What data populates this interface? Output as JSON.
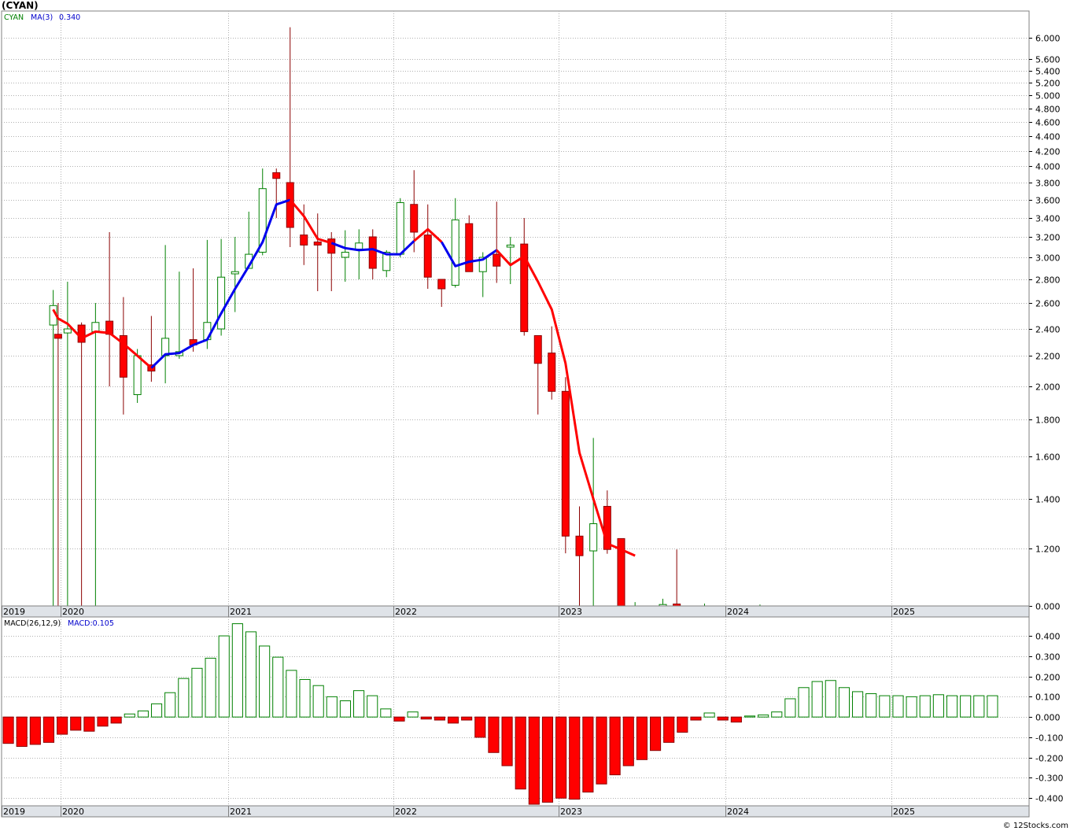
{
  "title": "(CYAN)",
  "watermark": "© 12Stocks.com",
  "legend_price": {
    "ma_label": "MA(3)",
    "ticker": "CYAN",
    "ma_value": "0.340"
  },
  "legend_macd": {
    "name": "MACD(26,12,9)",
    "value": "MACD:0.105"
  },
  "chart_data": [
    {
      "type": "candlestick",
      "panel": "price",
      "yticks": [
        "0.000",
        "1.200",
        "1.400",
        "1.600",
        "1.800",
        "2.000",
        "2.200",
        "2.400",
        "2.600",
        "2.800",
        "3.000",
        "3.200",
        "3.400",
        "3.600",
        "3.800",
        "4.000",
        "4.200",
        "4.400",
        "4.600",
        "4.800",
        "5.000",
        "5.200",
        "5.400",
        "5.600",
        "6.000"
      ],
      "xticks": [
        "2019",
        "2020",
        "2021",
        "2022",
        "2023",
        "2024",
        "2025"
      ],
      "up_color": "#008000",
      "down_color": "#ff0000",
      "ma_up_color": "#0000ee",
      "ma_down_color": "#ff0000",
      "candles": [
        {
          "d": "2019-11",
          "o": 2.43,
          "h": 2.71,
          "l": 0.0,
          "c": 2.58
        },
        {
          "d": "2019-12",
          "o": 2.36,
          "h": 2.6,
          "l": 0.0,
          "c": 2.33
        },
        {
          "d": "2020-01",
          "o": 2.37,
          "h": 2.78,
          "l": 0.0,
          "c": 2.4
        },
        {
          "d": "2020-02",
          "o": 2.43,
          "h": 2.45,
          "l": 0.0,
          "c": 2.3
        },
        {
          "d": "2020-03",
          "o": 2.38,
          "h": 2.6,
          "l": 0.0,
          "c": 2.45
        },
        {
          "d": "2020-04",
          "o": 2.46,
          "h": 3.25,
          "l": 2.0,
          "c": 2.36
        },
        {
          "d": "2020-05",
          "o": 2.35,
          "h": 2.65,
          "l": 1.83,
          "c": 2.06
        },
        {
          "d": "2020-06",
          "o": 1.95,
          "h": 2.25,
          "l": 1.9,
          "c": 2.2
        },
        {
          "d": "2020-07",
          "o": 2.14,
          "h": 2.5,
          "l": 2.03,
          "c": 2.1
        },
        {
          "d": "2020-08",
          "o": 2.2,
          "h": 3.12,
          "l": 2.02,
          "c": 2.33
        },
        {
          "d": "2020-09",
          "o": 2.2,
          "h": 2.87,
          "l": 2.18,
          "c": 2.23
        },
        {
          "d": "2020-10",
          "o": 2.32,
          "h": 2.9,
          "l": 2.23,
          "c": 2.28
        },
        {
          "d": "2020-11",
          "o": 2.32,
          "h": 3.17,
          "l": 2.25,
          "c": 2.45
        },
        {
          "d": "2020-12",
          "o": 2.4,
          "h": 3.18,
          "l": 2.35,
          "c": 2.82
        },
        {
          "d": "2021-01",
          "o": 2.85,
          "h": 3.2,
          "l": 2.53,
          "c": 2.87
        },
        {
          "d": "2021-02",
          "o": 2.9,
          "h": 3.47,
          "l": 2.9,
          "c": 3.03
        },
        {
          "d": "2021-03",
          "o": 3.05,
          "h": 3.97,
          "l": 3.02,
          "c": 3.73
        },
        {
          "d": "2021-04",
          "o": 3.92,
          "h": 3.97,
          "l": 3.4,
          "c": 3.85
        },
        {
          "d": "2021-05",
          "o": 3.8,
          "h": 6.2,
          "l": 3.1,
          "c": 3.3
        },
        {
          "d": "2021-06",
          "o": 3.22,
          "h": 3.55,
          "l": 2.93,
          "c": 3.12
        },
        {
          "d": "2021-07",
          "o": 3.15,
          "h": 3.45,
          "l": 2.7,
          "c": 3.12
        },
        {
          "d": "2021-08",
          "o": 3.18,
          "h": 3.25,
          "l": 2.7,
          "c": 3.04
        },
        {
          "d": "2021-09",
          "o": 3.0,
          "h": 3.27,
          "l": 2.78,
          "c": 3.05
        },
        {
          "d": "2021-10",
          "o": 3.08,
          "h": 3.28,
          "l": 2.8,
          "c": 3.14
        },
        {
          "d": "2021-11",
          "o": 3.2,
          "h": 3.28,
          "l": 2.8,
          "c": 2.9
        },
        {
          "d": "2021-12",
          "o": 2.88,
          "h": 3.07,
          "l": 2.82,
          "c": 3.05
        },
        {
          "d": "2022-01",
          "o": 3.03,
          "h": 3.62,
          "l": 3.0,
          "c": 3.57
        },
        {
          "d": "2022-02",
          "o": 3.55,
          "h": 3.95,
          "l": 3.05,
          "c": 3.25
        },
        {
          "d": "2022-03",
          "o": 3.22,
          "h": 3.55,
          "l": 2.72,
          "c": 2.82
        },
        {
          "d": "2022-04",
          "o": 2.8,
          "h": 2.8,
          "l": 2.57,
          "c": 2.72
        },
        {
          "d": "2022-05",
          "o": 2.75,
          "h": 3.62,
          "l": 2.73,
          "c": 3.38
        },
        {
          "d": "2022-06",
          "o": 3.34,
          "h": 3.43,
          "l": 2.87,
          "c": 2.87
        },
        {
          "d": "2022-07",
          "o": 2.87,
          "h": 3.05,
          "l": 2.65,
          "c": 3.0
        },
        {
          "d": "2022-08",
          "o": 3.03,
          "h": 3.58,
          "l": 2.77,
          "c": 2.92
        },
        {
          "d": "2022-09",
          "o": 3.1,
          "h": 3.2,
          "l": 2.76,
          "c": 3.12
        },
        {
          "d": "2022-10",
          "o": 3.13,
          "h": 3.4,
          "l": 2.35,
          "c": 2.38
        },
        {
          "d": "2022-11",
          "o": 2.35,
          "h": 2.35,
          "l": 1.83,
          "c": 2.15
        },
        {
          "d": "2022-12",
          "o": 2.22,
          "h": 2.42,
          "l": 1.92,
          "c": 1.97
        },
        {
          "d": "2023-01",
          "o": 1.97,
          "h": 2.06,
          "l": 1.1,
          "c": 1.25
        },
        {
          "d": "2023-02",
          "o": 1.25,
          "h": 1.37,
          "l": 0.0,
          "c": 1.05
        },
        {
          "d": "2023-03",
          "o": 1.15,
          "h": 1.7,
          "l": 0.0,
          "c": 1.3
        },
        {
          "d": "2023-04",
          "o": 1.37,
          "h": 1.44,
          "l": 1.09,
          "c": 1.18
        },
        {
          "d": "2023-05",
          "o": 1.24,
          "h": 1.24,
          "l": 0.0,
          "c": 0.0
        },
        {
          "d": "2023-06",
          "o": 0.0,
          "h": 0.08,
          "l": 0.0,
          "c": 0.0
        },
        {
          "d": "2023-07",
          "o": 0.0,
          "h": 0.0,
          "l": 0.0,
          "c": 0.0
        },
        {
          "d": "2023-08",
          "o": 0.0,
          "h": 0.15,
          "l": 0.0,
          "c": 0.03
        },
        {
          "d": "2023-09",
          "o": 0.04,
          "h": 1.18,
          "l": 0.0,
          "c": 0.0
        },
        {
          "d": "2023-10",
          "o": 0.0,
          "h": 0.0,
          "l": 0.0,
          "c": 0.0
        },
        {
          "d": "2023-11",
          "o": 0.0,
          "h": 0.05,
          "l": 0.0,
          "c": 0.0
        },
        {
          "d": "2023-12",
          "o": 0.0,
          "h": 0.0,
          "l": 0.0,
          "c": 0.0
        },
        {
          "d": "2024-01",
          "o": 0.0,
          "h": 0.0,
          "l": 0.0,
          "c": 0.0
        },
        {
          "d": "2024-02",
          "o": 0.0,
          "h": 0.0,
          "l": 0.0,
          "c": 0.0
        },
        {
          "d": "2024-03",
          "o": 0.0,
          "h": 0.03,
          "l": 0.0,
          "c": 0.0
        }
      ],
      "ma3": [
        2.55,
        2.48,
        2.44,
        2.33,
        2.38,
        2.37,
        2.29,
        2.2,
        2.12,
        2.21,
        2.22,
        2.28,
        2.32,
        2.52,
        2.72,
        2.92,
        3.15,
        3.55,
        3.6,
        3.42,
        3.18,
        3.14,
        3.09,
        3.07,
        3.08,
        3.03,
        3.03,
        3.16,
        3.28,
        3.15,
        2.92,
        2.96,
        2.98,
        3.07,
        2.93,
        3.01,
        2.78,
        2.55,
        2.15,
        1.62,
        1.4,
        1.22,
        1.18,
        1.05,
        0.78,
        0.38,
        0.0,
        0.0,
        0.0,
        0.0,
        0.0,
        0.0,
        0.0,
        0.0
      ],
      "ma3_segments": [
        {
          "from": "2019-11",
          "to": "2020-02",
          "color": "red"
        },
        {
          "from": "2020-02",
          "to": "2020-07",
          "color": "red"
        },
        {
          "from": "2020-07",
          "to": "2021-05",
          "color": "blue"
        },
        {
          "from": "2021-05",
          "to": "2021-08",
          "color": "red"
        },
        {
          "from": "2021-08",
          "to": "2022-02",
          "color": "blue"
        },
        {
          "from": "2022-02",
          "to": "2022-04",
          "color": "red"
        },
        {
          "from": "2022-04",
          "to": "2022-08",
          "color": "blue"
        },
        {
          "from": "2022-08",
          "to": "2023-06",
          "color": "red"
        }
      ]
    },
    {
      "type": "bar",
      "panel": "macd",
      "name": "MACD(26,12,9)",
      "yticks": [
        "-0.400",
        "-0.300",
        "-0.200",
        "-0.100",
        "0.000",
        "0.100",
        "0.200",
        "0.300",
        "0.400"
      ],
      "ylim": [
        -0.43,
        0.47
      ],
      "xticks": [
        "2019",
        "2020",
        "2021",
        "2022",
        "2023",
        "2024",
        "2025"
      ],
      "pos_color": "#008000",
      "neg_color": "#ff0000",
      "values": [
        -0.13,
        -0.145,
        -0.135,
        -0.125,
        -0.085,
        -0.065,
        -0.07,
        -0.045,
        -0.03,
        0.015,
        0.03,
        0.065,
        0.12,
        0.19,
        0.24,
        0.29,
        0.4,
        0.46,
        0.42,
        0.35,
        0.295,
        0.23,
        0.185,
        0.155,
        0.1,
        0.08,
        0.13,
        0.105,
        0.04,
        -0.02,
        0.025,
        -0.01,
        -0.015,
        -0.03,
        -0.015,
        -0.1,
        -0.175,
        -0.24,
        -0.355,
        -0.43,
        -0.42,
        -0.4,
        -0.405,
        -0.37,
        -0.33,
        -0.285,
        -0.24,
        -0.21,
        -0.165,
        -0.125,
        -0.075,
        -0.015,
        0.02,
        -0.015,
        -0.025,
        0.005,
        0.01,
        0.025,
        0.09,
        0.145,
        0.175,
        0.18,
        0.145,
        0.125,
        0.115,
        0.105,
        0.105,
        0.1,
        0.105,
        0.11,
        0.105,
        0.105,
        0.105,
        0.105
      ]
    }
  ]
}
